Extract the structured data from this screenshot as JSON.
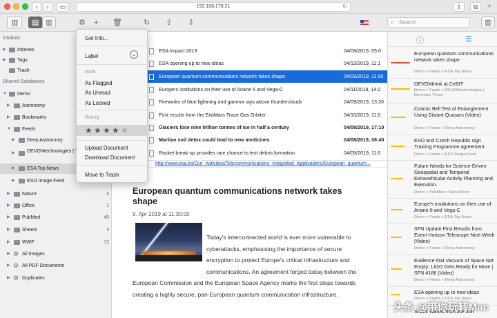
{
  "browser": {
    "url": "192.168.178.21"
  },
  "toolbar": {
    "search_placeholder": "Search"
  },
  "sidebar": {
    "globals_header": "Globals",
    "globals": [
      {
        "label": "Inboxes"
      },
      {
        "label": "Tags"
      },
      {
        "label": "Trash"
      }
    ],
    "shared_header": "Shared Databases",
    "items": [
      {
        "label": "Demo",
        "count": ""
      },
      {
        "label": "Astronomy",
        "count": ""
      },
      {
        "label": "Bookmarks",
        "count": ""
      },
      {
        "label": "Feeds",
        "count": ""
      },
      {
        "label": "Deep Astronomy",
        "count": ""
      },
      {
        "label": "DEVONtechnologies | Times",
        "count": ""
      },
      {
        "label": "ESA Top News",
        "count": ""
      },
      {
        "label": "ESO Image Feed",
        "count": ""
      },
      {
        "label": "Nature",
        "count": "4"
      },
      {
        "label": "Office",
        "count": "1"
      },
      {
        "label": "PubMed",
        "count": "40"
      },
      {
        "label": "Sheets",
        "count": "4"
      },
      {
        "label": "WWF",
        "count": "12"
      },
      {
        "label": "All Images",
        "count": ""
      },
      {
        "label": "All PDF Documents",
        "count": ""
      },
      {
        "label": "Duplicates",
        "count": ""
      }
    ]
  },
  "list": {
    "rows": [
      {
        "title": "ESA Impact 2019",
        "date": "04/09/2019, 05:0"
      },
      {
        "title": "ESA opening up to new ideas",
        "date": "04/12/2019, 11:1"
      },
      {
        "title": "European quantum communications network takes shape",
        "date": "04/09/2019, 11:30"
      },
      {
        "title": "Europe's institutions on their use of Ariane 6 and Vega-C",
        "date": "04/11/2019, 14:2"
      },
      {
        "title": "Fireworks of blue lightning and gamma rays above thunderclouds",
        "date": "04/09/2019, 13:20"
      },
      {
        "title": "First results from the ExoMars Trace Gas Orbiter",
        "date": "04/10/2019, 11:0"
      },
      {
        "title": "Glaciers lose nine trillion tonnes of ice in half a century",
        "date": "04/08/2019, 17:10"
      },
      {
        "title": "Martian soil detox could lead to new medicines",
        "date": "04/08/2019, 08:40"
      },
      {
        "title": "Rocket break-up provides rare chance to test debris formation",
        "date": "04/09/2019, 11:0"
      }
    ],
    "url": "http://www.esa.int/Our_Activities/Telecommunications_Integrated_Applications/European_quantum..."
  },
  "article": {
    "title": "European quantum communications network takes shape",
    "date": "9. Apr 2019 at 11:30:00",
    "body_lines": [
      "Today's interconnected world is ever more vulnerable to",
      "cyberattacks, emphasising the importance of secure",
      "encryption to protect Europe's critical infrastructure and",
      "communications. An agreement forged today between the",
      "European Commission and the European Space Agency marks the first steps towards",
      "creating a highly secure, pan-European quantum communication infrastructure."
    ]
  },
  "context_menu": {
    "get_info": "Get Info...",
    "label": "Label",
    "mark_header": "Mark",
    "as_flagged": "As Flagged",
    "as_unread": "As Unread",
    "as_locked": "As Locked",
    "rating_header": "Rating",
    "rating": 4,
    "rating_max": 5,
    "upload": "Upload Document",
    "download": "Download Document",
    "move_to_trash": "Move to Trash"
  },
  "right_panel": {
    "items": [
      {
        "title": "European quantum communications network takes shape",
        "path": "Demo > Feeds > ESA Top News",
        "color": "#e74c3c"
      },
      {
        "title": "DEVONthink at CeBIT",
        "path": "Demo > Feeds > DEVONtechnologies | Devonian Times",
        "color": "#f5c000"
      },
      {
        "title": "Cosmic Bell Test of Entanglement Using Distant Quasars (Video)",
        "path": "Demo > Feeds > Deep Astronomy",
        "color": "#f5c000"
      },
      {
        "title": "ESO and Czech Republic sign Training Programme agreement",
        "path": "Demo > Feeds > ESO Image Feed",
        "color": "#f5c000"
      },
      {
        "title": "Future Needs for Science-Driven Geospatial and Temporal Extravehicular Activity Planning and Execution.",
        "path": "Demo > PubMed > Mars Rover",
        "color": "#f5c000"
      },
      {
        "title": "Europe's institutions on their use of Ariane 6 and Vega-C",
        "path": "Demo > Feeds > ESA Top News",
        "color": "#f5c000"
      },
      {
        "title": "SFN Update First Results from Event Horizon Telescope Next Week (Video)",
        "path": "Demo > Feeds > Deep Astronomy",
        "color": "#f5c000"
      },
      {
        "title": "Evidence that Vacuum of Space Not Empty; LIGO Gets Ready for More | SFN #186 (Video)",
        "path": "Demo > Feeds > Deep Astronomy",
        "color": "#f5c000"
      },
      {
        "title": "ESA opening up to new ideas",
        "path": "Demo > Feeds > ESA Top News",
        "color": "#f5c000"
      },
      {
        "title": "Shock Waves from the Sun",
        "path": "",
        "color": "#f5c000"
      }
    ]
  },
  "watermark": "头条 @带你玩转Mac"
}
